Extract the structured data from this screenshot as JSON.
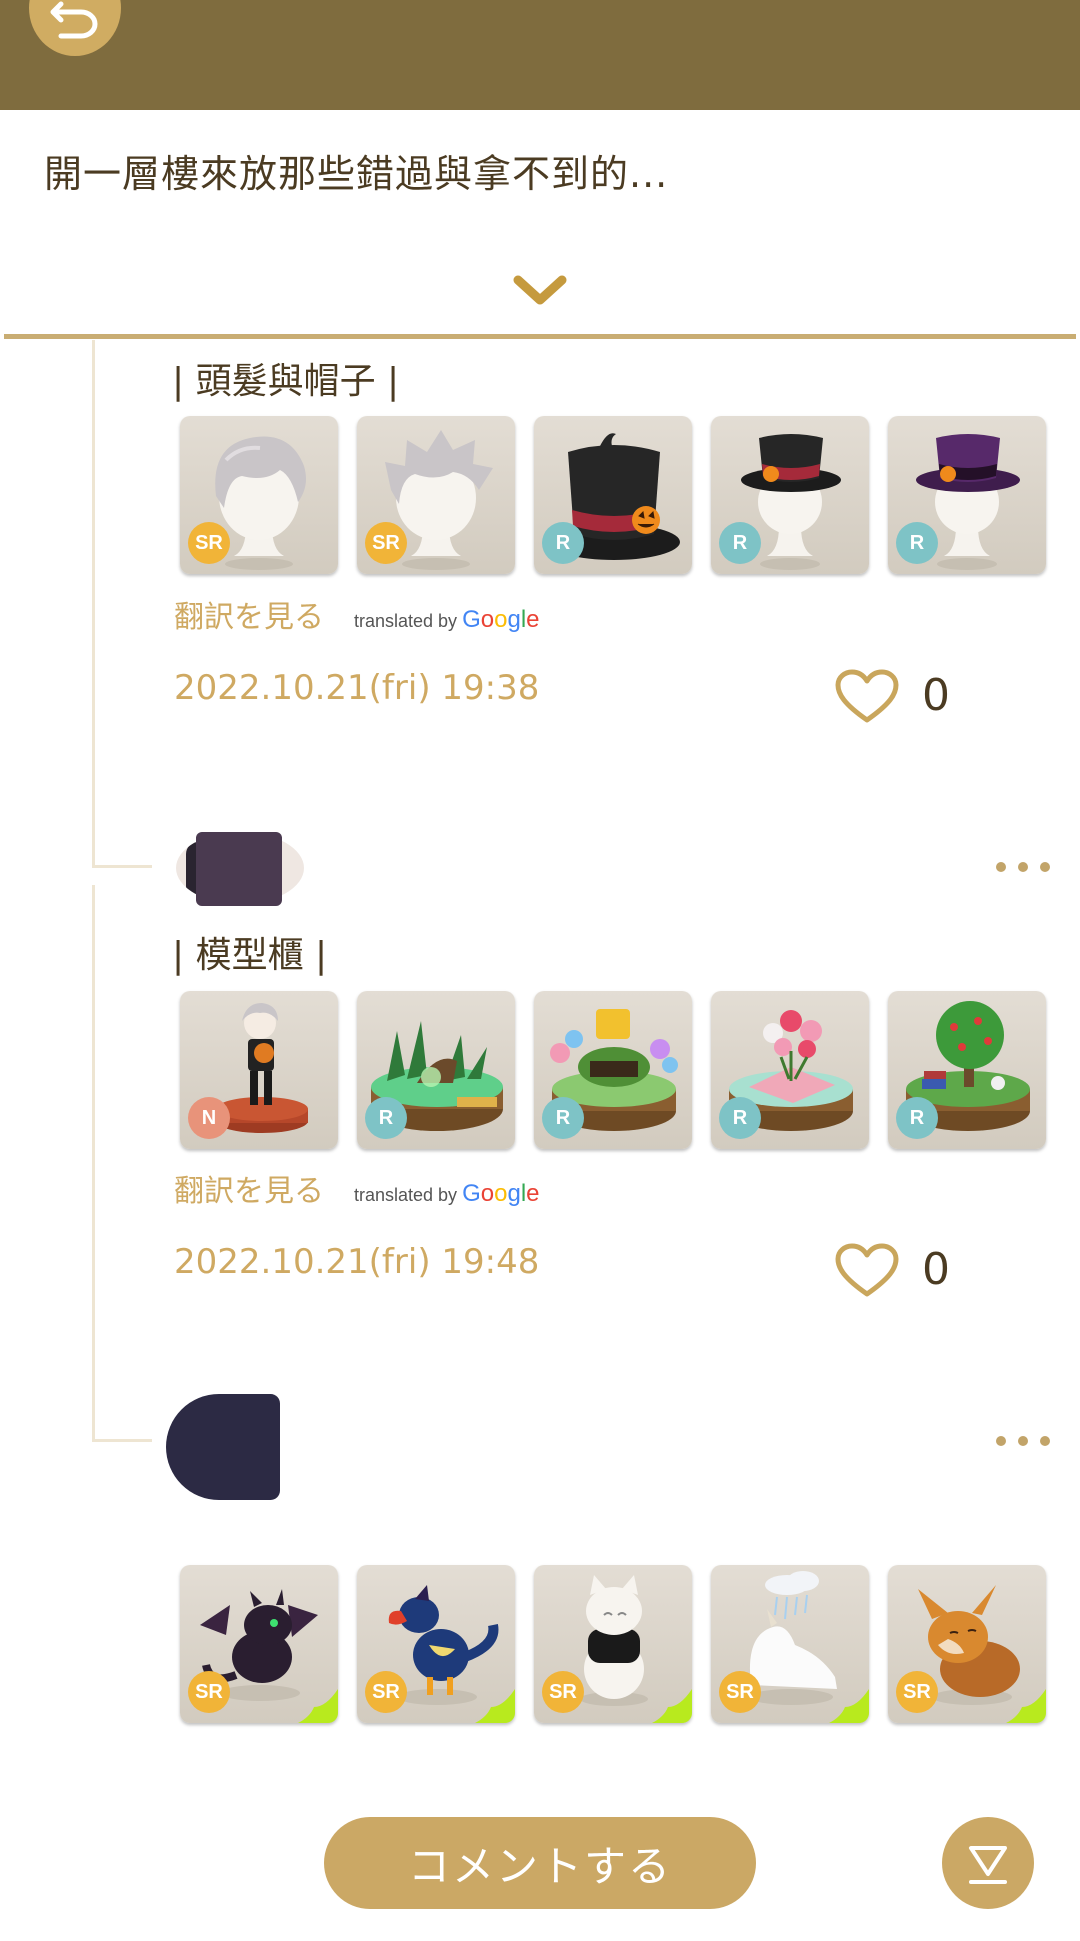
{
  "header": {
    "back_icon": "undo-arrow-icon",
    "color": "#7f6c3e"
  },
  "topic": {
    "title": "開一層樓來放那些錯過與拿不到的...",
    "expand_icon": "chevron-down-icon"
  },
  "posts": [
    {
      "title": "| 頭髮與帽子 |",
      "items": [
        {
          "name": "silver-wavy-hair",
          "rarity": "SR"
        },
        {
          "name": "silver-spiky-hair",
          "rarity": "SR"
        },
        {
          "name": "black-pumpkin-top-hat",
          "rarity": "R"
        },
        {
          "name": "black-top-hat-on-head",
          "rarity": "R"
        },
        {
          "name": "purple-top-hat-on-head",
          "rarity": "R"
        }
      ],
      "translate_label": "翻訳を見る",
      "translated_by": "translated by",
      "google": [
        "G",
        "o",
        "o",
        "g",
        "l",
        "e"
      ],
      "timestamp": "2022.10.21(fri) 19:38",
      "likes": "0"
    },
    {
      "title": "| 模型櫃 |",
      "items": [
        {
          "name": "figure-boy-with-cat",
          "rarity": "N"
        },
        {
          "name": "green-plants-diorama",
          "rarity": "R"
        },
        {
          "name": "20th-anniversary-diorama",
          "rarity": "R"
        },
        {
          "name": "picnic-flowers-diorama",
          "rarity": "R"
        },
        {
          "name": "apple-tree-diorama",
          "rarity": "R"
        }
      ],
      "translate_label": "翻訳を見る",
      "translated_by": "translated by",
      "google": [
        "G",
        "o",
        "o",
        "g",
        "l",
        "e"
      ],
      "timestamp": "2022.10.21(fri) 19:48",
      "likes": "0"
    },
    {
      "title": "",
      "items": [
        {
          "name": "black-dragon-pet",
          "rarity": "SR"
        },
        {
          "name": "blue-raptor-pet",
          "rarity": "SR"
        },
        {
          "name": "black-white-cat-pet",
          "rarity": "SR"
        },
        {
          "name": "white-cloud-unicorn-pet",
          "rarity": "SR"
        },
        {
          "name": "brown-fox-pet",
          "rarity": "SR"
        }
      ]
    }
  ],
  "footer": {
    "comment_label": "コメントする",
    "scroll_icon": "scroll-to-bottom-icon"
  }
}
